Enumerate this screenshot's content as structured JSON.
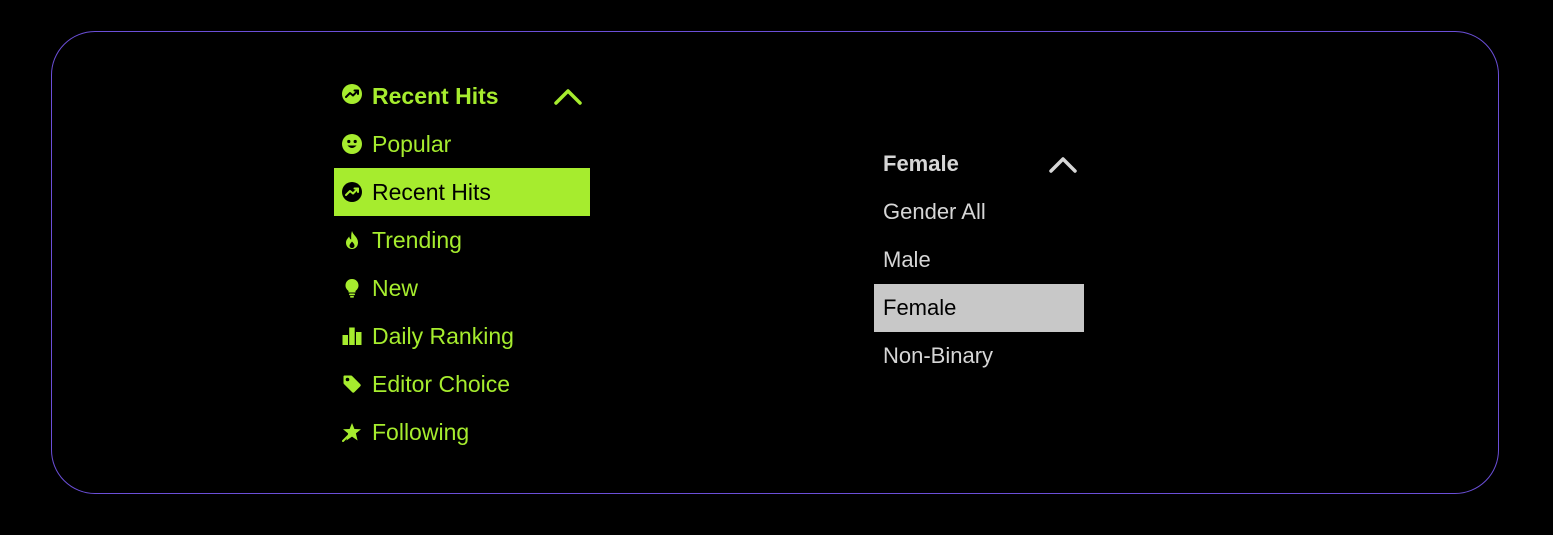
{
  "colors": {
    "accent": "#a6ec2e",
    "panel_border": "#6b4fd8",
    "background": "#000000",
    "gender_text": "#d6d6d6",
    "gender_selected_bg": "#c8c8c8"
  },
  "category_dropdown": {
    "current": {
      "label": "Recent Hits",
      "icon": "trending-chart-icon"
    },
    "expanded": true,
    "items": [
      {
        "label": "Popular",
        "icon": "smiley-icon",
        "selected": false
      },
      {
        "label": "Recent Hits",
        "icon": "trending-chart-icon",
        "selected": true
      },
      {
        "label": "Trending",
        "icon": "flame-icon",
        "selected": false
      },
      {
        "label": "New",
        "icon": "lightbulb-icon",
        "selected": false
      },
      {
        "label": "Daily Ranking",
        "icon": "bar-chart-icon",
        "selected": false
      },
      {
        "label": "Editor Choice",
        "icon": "tag-icon",
        "selected": false
      },
      {
        "label": "Following",
        "icon": "star-icon",
        "selected": false
      }
    ]
  },
  "gender_dropdown": {
    "current": {
      "label": "Female"
    },
    "expanded": true,
    "items": [
      {
        "label": "Gender All",
        "selected": false
      },
      {
        "label": "Male",
        "selected": false
      },
      {
        "label": "Female",
        "selected": true
      },
      {
        "label": "Non-Binary",
        "selected": false
      }
    ]
  }
}
